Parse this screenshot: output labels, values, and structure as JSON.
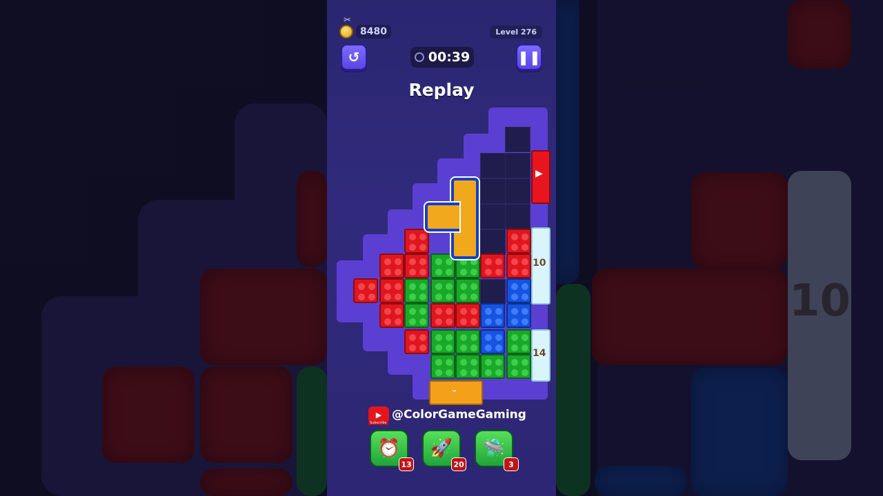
{
  "hud": {
    "coins": "8480",
    "level": "Level 276",
    "timer": "00:39",
    "undo_icon": "undo-icon",
    "pause_icon": "pause-icon"
  },
  "title": "Replay",
  "board": {
    "exits": [
      {
        "color": "red",
        "label": ""
      },
      {
        "color": "cyan",
        "label": "10"
      },
      {
        "color": "cyan",
        "label": "14"
      },
      {
        "color": "orange",
        "label": ""
      }
    ]
  },
  "channel": {
    "icon": "youtube-icon",
    "badge": "Subscribe",
    "handle": "@ColorGameGaming"
  },
  "powerups": [
    {
      "name": "timer-freeze",
      "icon": "clock-icon",
      "count": "13"
    },
    {
      "name": "rocket",
      "icon": "rocket-icon",
      "count": "20"
    },
    {
      "name": "ufo",
      "icon": "ufo-icon",
      "count": "3"
    }
  ],
  "background": {
    "number": "10"
  },
  "colors": {
    "panel": "#2c2674",
    "red": "#e0161f",
    "green": "#1aa829",
    "blue": "#1553e0",
    "button": "#6a56f5"
  }
}
